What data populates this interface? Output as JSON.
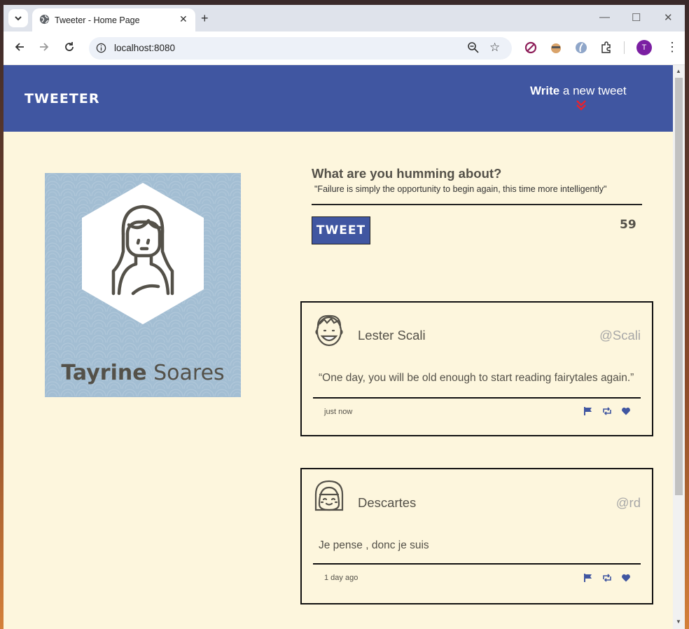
{
  "browser": {
    "tab_title": "Tweeter - Home Page",
    "url": "localhost:8080",
    "profile_initial": "T",
    "new_tab_label": "+",
    "tab_close": "✕",
    "min": "—",
    "max": "☐",
    "close": "✕"
  },
  "nav": {
    "logo": "TWEETER",
    "write_bold": "Write",
    "write_rest": " a new tweet"
  },
  "profile": {
    "first_name": "Tayrine",
    "last_name": " Soares"
  },
  "compose": {
    "heading": "What are you humming about?",
    "quote": "\"Failure is simply the opportunity to begin again, this time more intelligently\"",
    "button": "TWEET",
    "counter": "59"
  },
  "tweets": [
    {
      "name": "Lester Scali",
      "handle": "@Scali",
      "content": "“One day, you will be old enough to start reading fairytales again.”",
      "time": "just now"
    },
    {
      "name": "Descartes",
      "handle": "@rd",
      "content": "Je pense , donc je suis",
      "time": "1 day ago"
    }
  ],
  "colors": {
    "brand": "#4056a1",
    "background": "#fdf6dd",
    "text": "#545149",
    "accent": "#e8222e"
  }
}
